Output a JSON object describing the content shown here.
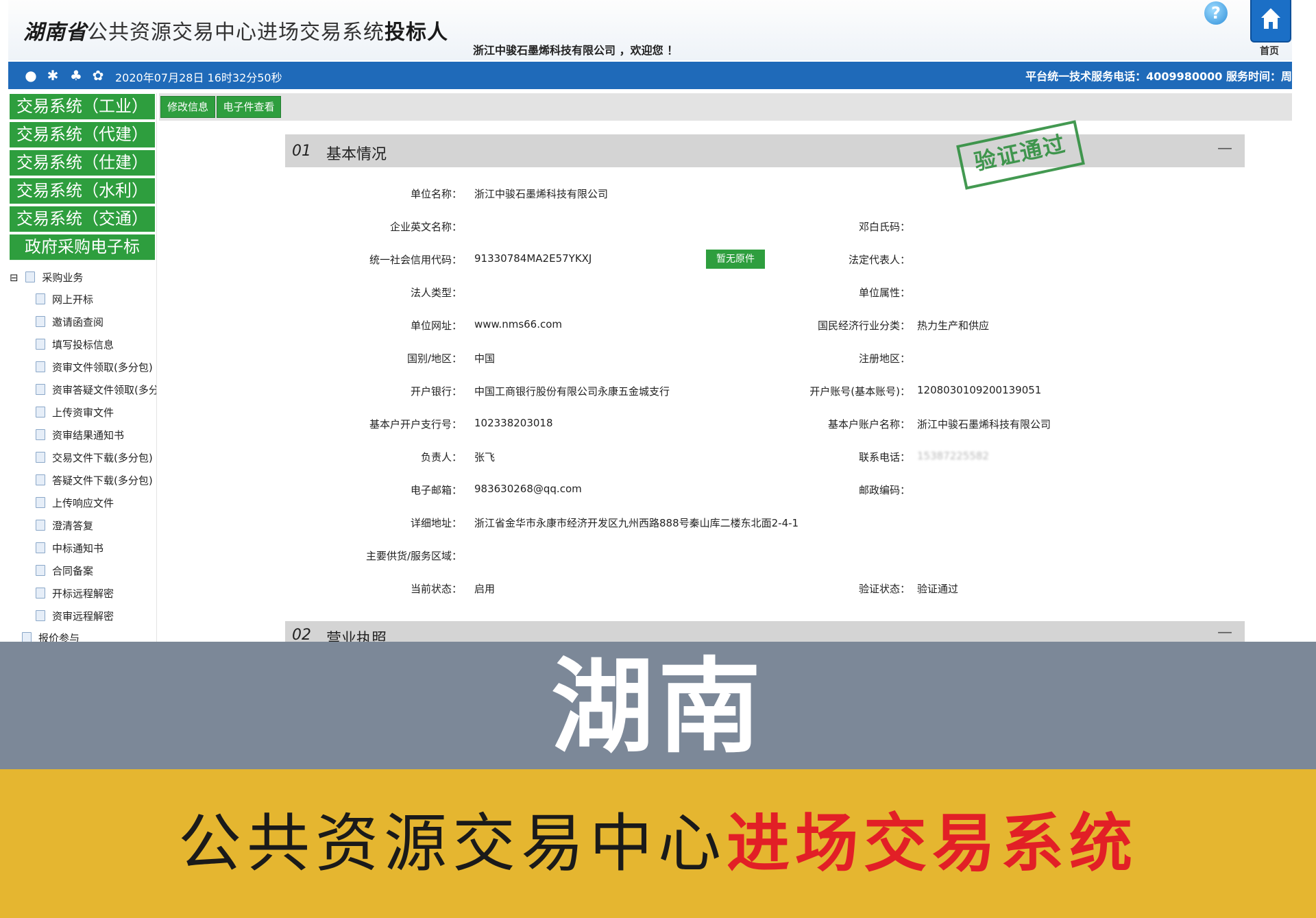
{
  "header": {
    "province": "湖南省",
    "system_name": "公共资源交易中心进场交易系统",
    "role": "投标人",
    "welcome": "浙江中骏石墨烯科技有限公司 ，欢迎您 ！",
    "help_icon": "?",
    "home_label": "首页"
  },
  "toolbar": {
    "icons": [
      "chat-icon",
      "gear-icon",
      "users-icon",
      "palette-icon"
    ],
    "datetime": "2020年07月28日 16时32分50秒",
    "service": "平台统一技术服务电话：4009980000 服务时间：周"
  },
  "nav": {
    "buttons": [
      "交易系统（工业）",
      "交易系统（代建）",
      "交易系统（仕建）",
      "交易系统（水利）",
      "交易系统（交通）",
      "政府采购电子标"
    ],
    "tree_root": "采购业务",
    "tree_items": [
      "网上开标",
      "邀请函查阅",
      "填写投标信息",
      "资审文件领取(多分包)",
      "资审答疑文件领取(多分包)",
      "上传资审文件",
      "资审结果通知书",
      "交易文件下载(多分包)",
      "答疑文件下载(多分包)",
      "上传响应文件",
      "澄清答复",
      "中标通知书",
      "合同备案",
      "开标远程解密",
      "资审远程解密"
    ],
    "tree_next": "报价参与"
  },
  "tabs": [
    "修改信息",
    "电子件查看"
  ],
  "panel": {
    "num": "01",
    "title": "基本情况",
    "collapse": "—",
    "stamp": "验证通过"
  },
  "fields": {
    "unit_name_label": "单位名称：",
    "unit_name": "浙江中骏石墨烯科技有限公司",
    "en_name_label": "企业英文名称：",
    "en_name": "",
    "deng_label": "邓白氏码：",
    "deng": "",
    "credit_label": "统一社会信用代码：",
    "credit": "91330784MA2E57YKXJ",
    "no_original": "暂无原件",
    "legal_rep_label": "法定代表人：",
    "legal_rep": "",
    "legal_type_label": "法人类型：",
    "legal_type": "",
    "unit_attr_label": "单位属性：",
    "unit_attr": "",
    "website_label": "单位网址：",
    "website": "www.nms66.com",
    "industry_label": "国民经济行业分类：",
    "industry": "热力生产和供应",
    "country_label": "国别/地区：",
    "country": "中国",
    "reg_area_label": "注册地区：",
    "reg_area": "",
    "bank_label": "开户银行：",
    "bank": "中国工商银行股份有限公司永康五金城支行",
    "account_label": "开户账号(基本账号)：",
    "account": "1208030109200139051",
    "branch_no_label": "基本户开户支行号：",
    "branch_no": "102338203018",
    "account_name_label": "基本户账户名称：",
    "account_name": "浙江中骏石墨烯科技有限公司",
    "manager_label": "负责人：",
    "manager": "张飞",
    "phone_label": "联系电话：",
    "phone": "15387225582",
    "email_label": "电子邮箱：",
    "email": "983630268@qq.com",
    "postcode_label": "邮政编码：",
    "postcode": "",
    "address_label": "详细地址：",
    "address": "浙江省金华市永康市经济开发区九州西路888号秦山库二楼东北面2-4-1",
    "supply_label": "主要供货/服务区域：",
    "supply": "",
    "status_label": "当前状态：",
    "status": "启用",
    "verify_label": "验证状态：",
    "verify": "验证通过"
  },
  "panel2": {
    "num": "02",
    "title": "营业执照",
    "collapse": "—"
  },
  "banner": {
    "title": "湖南",
    "sub_plain": "公共资源交易中心",
    "sub_red": "进场交易系统",
    "gray": "#7c8898",
    "yellow": "#e5b630",
    "red": "#e21f26"
  },
  "colors": {
    "nav_green": "#2e9e3e",
    "toolbar_blue": "#1f6ab9"
  }
}
